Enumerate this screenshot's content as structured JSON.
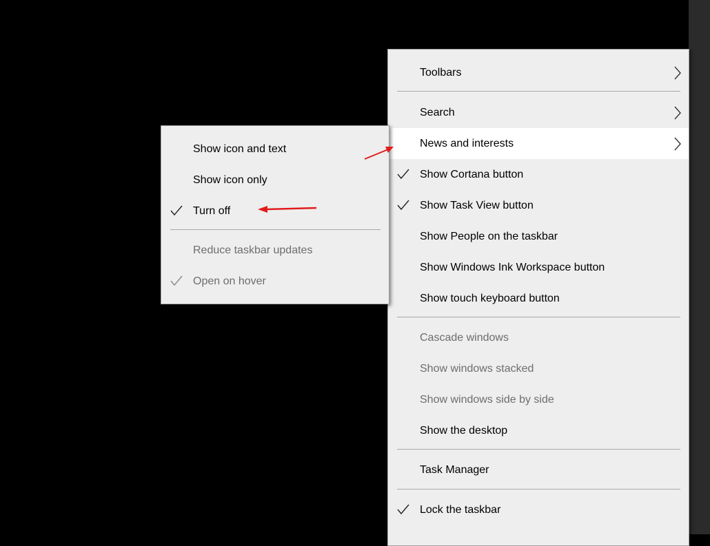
{
  "colors": {
    "background": "#000000",
    "menu_bg": "#eeeeee",
    "highlight_bg": "#ffffff",
    "disabled_text": "#6d6d6d",
    "annotation_arrow": "#e21b1b"
  },
  "main_menu": {
    "toolbars": "Toolbars",
    "search": "Search",
    "news_and_interests": "News and interests",
    "show_cortana_button": "Show Cortana button",
    "show_task_view_button": "Show Task View button",
    "show_people": "Show People on the taskbar",
    "show_ink_workspace": "Show Windows Ink Workspace button",
    "show_touch_keyboard": "Show touch keyboard button",
    "cascade_windows": "Cascade windows",
    "show_windows_stacked": "Show windows stacked",
    "show_windows_side_by_side": "Show windows side by side",
    "show_desktop": "Show the desktop",
    "task_manager": "Task Manager",
    "lock_taskbar": "Lock the taskbar"
  },
  "submenu": {
    "show_icon_and_text": "Show icon and text",
    "show_icon_only": "Show icon only",
    "turn_off": "Turn off",
    "reduce_taskbar_updates": "Reduce taskbar updates",
    "open_on_hover": "Open on hover"
  }
}
